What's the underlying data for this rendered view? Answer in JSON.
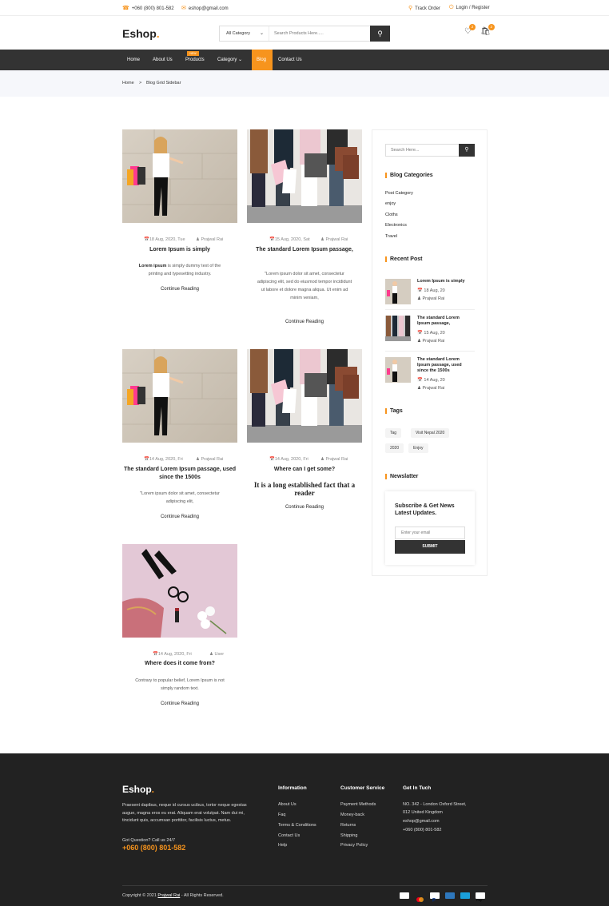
{
  "topbar": {
    "phone": "+060 (800) 801-582",
    "email": "eshop@gmail.com",
    "track_order": "Track Order",
    "login": "Login / Register"
  },
  "header": {
    "logo_text": "Eshop",
    "logo_dot": ".",
    "category_select": "All Category",
    "search_placeholder": "Search Products Here.....",
    "wishlist_count": "2",
    "cart_count": "2"
  },
  "nav": {
    "items": [
      "Home",
      "About Us",
      "Products",
      "Category",
      "Blog",
      "Contact Us"
    ],
    "new_badge": "NEW",
    "active": "Blog"
  },
  "breadcrumb": {
    "home": "Home",
    "separator": ">",
    "current": "Blog Grid Sidebar"
  },
  "posts": [
    {
      "date": "18 Aug, 2020, Tue",
      "author": "Prajwal Rai",
      "title": "Lorem Ipsum is simply",
      "excerpt_bold": "Lorem ipsum",
      "excerpt": " is simply dummy text of the printing and typesetting industry.",
      "more": "Continue Reading"
    },
    {
      "date": "15 Aug, 2020, Sat",
      "author": "Prajwal Rai",
      "title": "The standard Lorem Ipsum passage,",
      "excerpt": "\"Lorem ipsum dolor sit amet, consectetur adipiscing elit, sed do eiusmod tempor incididunt ut labore et dolore magna aliqua. Ut enim ad minim veniam,",
      "more": "Continue Reading"
    },
    {
      "date": "14 Aug, 2020, Fri",
      "author": "Prajwal Rai",
      "title": "The standard Lorem Ipsum passage, used since the 1500s",
      "excerpt": "\"Lorem ipsum dolor sit amet, consectetur adipiscing elit,",
      "more": "Continue Reading"
    },
    {
      "date": "14 Aug, 2020, Fri",
      "author": "Prajwal Rai",
      "title": "Where can I get some?",
      "excerpt": "It is a long established fact that a reader",
      "more": "Continue Reading"
    },
    {
      "date": "14 Aug, 2020, Fri",
      "author": "User",
      "title": "Where does it come from?",
      "excerpt": "Contrary to popular belief, Lorem Ipsum is not simply random text.",
      "more": "Continue Reading"
    }
  ],
  "sidebar": {
    "search_placeholder": "Search Here...",
    "categories_title": "Blog Categories",
    "categories": [
      "Post Category",
      "enjoy",
      "Cloths",
      "Electronics",
      "Travel"
    ],
    "recent_title": "Recent Post",
    "recent": [
      {
        "title": "Lorem Ipsum is simply",
        "date": "18 Aug, 20",
        "author": "Prajwal Rai"
      },
      {
        "title": "The standard Lorem Ipsum passage,",
        "date": "15 Aug, 20",
        "author": "Prajwal Rai"
      },
      {
        "title": "The standard Lorem Ipsum passage, used since the 1500s",
        "date": "14 Aug, 20",
        "author": "Prajwal Rai"
      }
    ],
    "tags_title": "Tags",
    "tags": [
      "Tag",
      "Visit Nepal 2020",
      "2020",
      "Enjoy"
    ],
    "newsletter_title": "Newslatter",
    "newsletter_heading": "Subscribe & Get News Latest Updates.",
    "newsletter_placeholder": "Enter your email",
    "newsletter_button": "SUBMIT"
  },
  "footer": {
    "logo_text": "Eshop",
    "logo_dot": ".",
    "about": "Praesent dapibus, neque id cursus ucibus, tortor neque egestas augue, magna eros eu erat. Aliquam erat volutpat. Nam dui mi, tincidunt quis, accumsan porttitor, facilisis luctus, metus.",
    "question": "Got Question? Call us 24/7",
    "phone": "+060 (800) 801-582",
    "information_title": "Information",
    "information": [
      "About Us",
      "Faq",
      "Terms & Conditions",
      "Contact Us",
      "Help"
    ],
    "service_title": "Customer Service",
    "service": [
      "Payment Methods",
      "Money-back",
      "Returns",
      "Shipping",
      "Privacy Policy"
    ],
    "contact_title": "Get In Tuch",
    "contact": [
      "NO. 342 - London Oxford Street,",
      "012 United Kingdom",
      "eshop@gmail.com",
      "+060 (800) 801-582"
    ],
    "copyright_pre": "Copyright © 2021",
    "copyright_name": "Prajwal Rai",
    "copyright_post": " - All Rights Reserved.",
    "payments": [
      "VISA",
      "MASTERCARD",
      "PAYPAL",
      "AMEX",
      "VISA",
      "APPLE PAY"
    ]
  },
  "colors": {
    "accent": "#f7941d",
    "dark": "#333333",
    "footer": "#222222"
  }
}
